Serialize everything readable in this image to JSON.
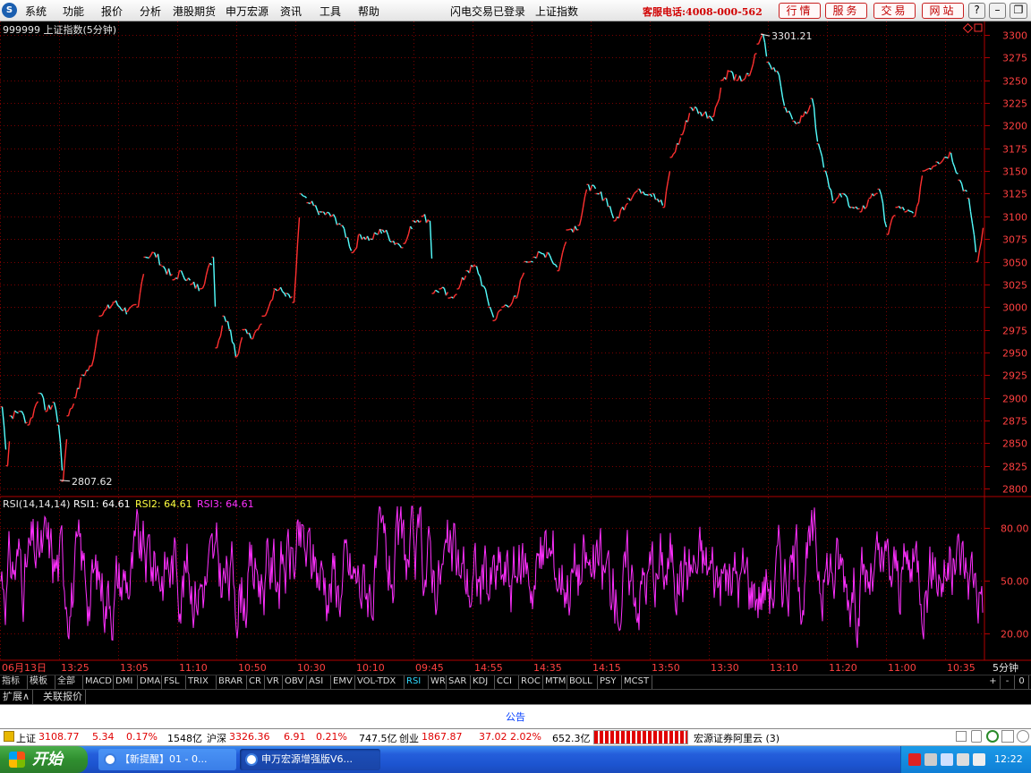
{
  "menubar": {
    "logo": "S",
    "items": [
      "系统",
      "功能",
      "报价",
      "分析",
      "港股期货",
      "申万宏源",
      "资讯",
      "工具",
      "帮助"
    ],
    "login_status": "闪电交易已登录",
    "index_title": "上证指数",
    "hotline": "客服电话:4008-000-562",
    "nav_buttons": [
      "行情",
      "服务",
      "交易",
      "网站"
    ],
    "window_buttons": [
      "?",
      "–",
      "❐",
      "✕"
    ]
  },
  "chart_header": {
    "code_title": "999999 上证指数(5分钟)"
  },
  "chart_data": [
    {
      "type": "line",
      "title": "999999 上证指数(5分钟)",
      "y_ticks": [
        2800,
        2825,
        2850,
        2875,
        2900,
        2925,
        2950,
        2975,
        3000,
        3025,
        3050,
        3075,
        3100,
        3125,
        3150,
        3175,
        3200,
        3225,
        3250,
        3275,
        3300
      ],
      "ylim": [
        2794,
        3307
      ],
      "x_labels": [
        "06月13日",
        "13:25",
        "13:05",
        "11:10",
        "10:50",
        "10:30",
        "10:10",
        "09:45",
        "14:55",
        "14:35",
        "14:15",
        "13:50",
        "13:30",
        "13:10",
        "11:20",
        "11:00",
        "10:35"
      ],
      "annotations": {
        "high": "3301.21",
        "low": "2807.62"
      },
      "colors": {
        "up": "#ff3030",
        "down": "#54ffff",
        "grid": "#7a0000"
      },
      "series": [
        {
          "name": "价格",
          "points": [
            [
              0,
              2890
            ],
            [
              6,
              2825
            ],
            [
              10,
              2880
            ],
            [
              20,
              2885
            ],
            [
              30,
              2870
            ],
            [
              42,
              2905
            ],
            [
              50,
              2885
            ],
            [
              58,
              2895
            ],
            [
              63,
              2870
            ],
            [
              68,
              2808
            ],
            [
              74,
              2880
            ],
            [
              82,
              2900
            ],
            [
              90,
              2925
            ],
            [
              100,
              2935
            ],
            [
              110,
              2990
            ],
            [
              125,
              3005
            ],
            [
              140,
              2995
            ],
            [
              152,
              3000
            ],
            [
              160,
              3055
            ],
            [
              170,
              3060
            ],
            [
              180,
              3045
            ],
            [
              192,
              3030
            ],
            [
              200,
              3040
            ],
            [
              212,
              3025
            ],
            [
              222,
              3020
            ],
            [
              236,
              3055
            ],
            [
              240,
              2955
            ],
            [
              248,
              2990
            ],
            [
              255,
              2975
            ],
            [
              262,
              2945
            ],
            [
              270,
              2975
            ],
            [
              280,
              2965
            ],
            [
              292,
              2990
            ],
            [
              305,
              3020
            ],
            [
              318,
              3015
            ],
            [
              326,
              3005
            ],
            [
              334,
              3125
            ],
            [
              342,
              3115
            ],
            [
              355,
              3105
            ],
            [
              368,
              3100
            ],
            [
              380,
              3090
            ],
            [
              392,
              3060
            ],
            [
              400,
              3080
            ],
            [
              412,
              3075
            ],
            [
              425,
              3085
            ],
            [
              440,
              3070
            ],
            [
              450,
              3070
            ],
            [
              460,
              3095
            ],
            [
              470,
              3100
            ],
            [
              478,
              3095
            ],
            [
              482,
              3015
            ],
            [
              490,
              3020
            ],
            [
              500,
              3010
            ],
            [
              510,
              3020
            ],
            [
              520,
              3040
            ],
            [
              530,
              3045
            ],
            [
              545,
              3000
            ],
            [
              550,
              2985
            ],
            [
              560,
              3000
            ],
            [
              575,
              3010
            ],
            [
              585,
              3050
            ],
            [
              595,
              3055
            ],
            [
              610,
              3060
            ],
            [
              622,
              3040
            ],
            [
              632,
              3085
            ],
            [
              645,
              3090
            ],
            [
              655,
              3135
            ],
            [
              665,
              3125
            ],
            [
              675,
              3120
            ],
            [
              685,
              3095
            ],
            [
              700,
              3120
            ],
            [
              712,
              3130
            ],
            [
              728,
              3125
            ],
            [
              740,
              3110
            ],
            [
              748,
              3165
            ],
            [
              760,
              3190
            ],
            [
              770,
              3220
            ],
            [
              780,
              3215
            ],
            [
              795,
              3210
            ],
            [
              805,
              3250
            ],
            [
              812,
              3260
            ],
            [
              822,
              3250
            ],
            [
              835,
              3255
            ],
            [
              845,
              3290
            ],
            [
              850,
              3301
            ],
            [
              856,
              3270
            ],
            [
              866,
              3260
            ],
            [
              875,
              3220
            ],
            [
              885,
              3205
            ],
            [
              895,
              3210
            ],
            [
              905,
              3230
            ],
            [
              912,
              3180
            ],
            [
              920,
              3150
            ],
            [
              930,
              3115
            ],
            [
              940,
              3125
            ],
            [
              950,
              3110
            ],
            [
              960,
              3105
            ],
            [
              970,
              3120
            ],
            [
              980,
              3130
            ],
            [
              990,
              3080
            ],
            [
              1000,
              3110
            ],
            [
              1010,
              3105
            ],
            [
              1020,
              3100
            ],
            [
              1030,
              3150
            ],
            [
              1045,
              3160
            ],
            [
              1060,
              3170
            ],
            [
              1070,
              3140
            ],
            [
              1080,
              3120
            ],
            [
              1090,
              3050
            ],
            [
              1098,
              3100
            ]
          ]
        }
      ]
    },
    {
      "type": "line",
      "title": "RSI(14,14,14)",
      "y_ticks": [
        20,
        50,
        80
      ],
      "ylim": [
        6,
        96
      ],
      "series": [
        {
          "name": "RSI1",
          "value": "64.61",
          "color": "#ffffff"
        },
        {
          "name": "RSI2",
          "value": "64.61",
          "color": "#ffff40"
        },
        {
          "name": "RSI3",
          "value": "64.61",
          "color": "#ff30ff"
        }
      ]
    }
  ],
  "rsi_header": {
    "label": "RSI(14,14,14)",
    "rsi1": "RSI1: 64.61",
    "rsi2": "RSI2: 64.61",
    "rsi3": "RSI3: 64.61"
  },
  "period_label": "5分钟",
  "indicator_tabs": [
    "指标",
    "模板",
    "全部",
    "MACD",
    "DMI",
    "DMA",
    "FSL",
    "TRIX",
    "BRAR",
    "CR",
    "VR",
    "OBV",
    "ASI",
    "EMV",
    "VOL-TDX",
    "RSI",
    "WR",
    "SAR",
    "KDJ",
    "CCI",
    "ROC",
    "MTM",
    "BOLL",
    "PSY",
    "MCST"
  ],
  "indicator_tools": [
    "+",
    "-",
    "0"
  ],
  "sub_tabs": [
    "扩展∧",
    "关联报价"
  ],
  "notice": "公告",
  "status": {
    "sh_label": "上证",
    "sh_price": "3108.77",
    "sh_change": "5.34",
    "sh_pct": "0.17%",
    "sh_amount": "1548亿",
    "hs_label": "沪深",
    "hs_price": "3326.36",
    "hs_change": "6.91",
    "hs_pct": "0.21%",
    "hs_amount": "747.5亿",
    "cy_label": "创业",
    "cy_price": "1867.87",
    "cy_change": "37.02",
    "cy_pct": "2.02%",
    "cy_amount": "652.3亿",
    "broker": "宏源证券阿里云 (3)"
  },
  "taskbar": {
    "start": "开始",
    "items": [
      "【新提醒】01 - 0...",
      "申万宏源增强版V6..."
    ],
    "clock": "12:22"
  }
}
